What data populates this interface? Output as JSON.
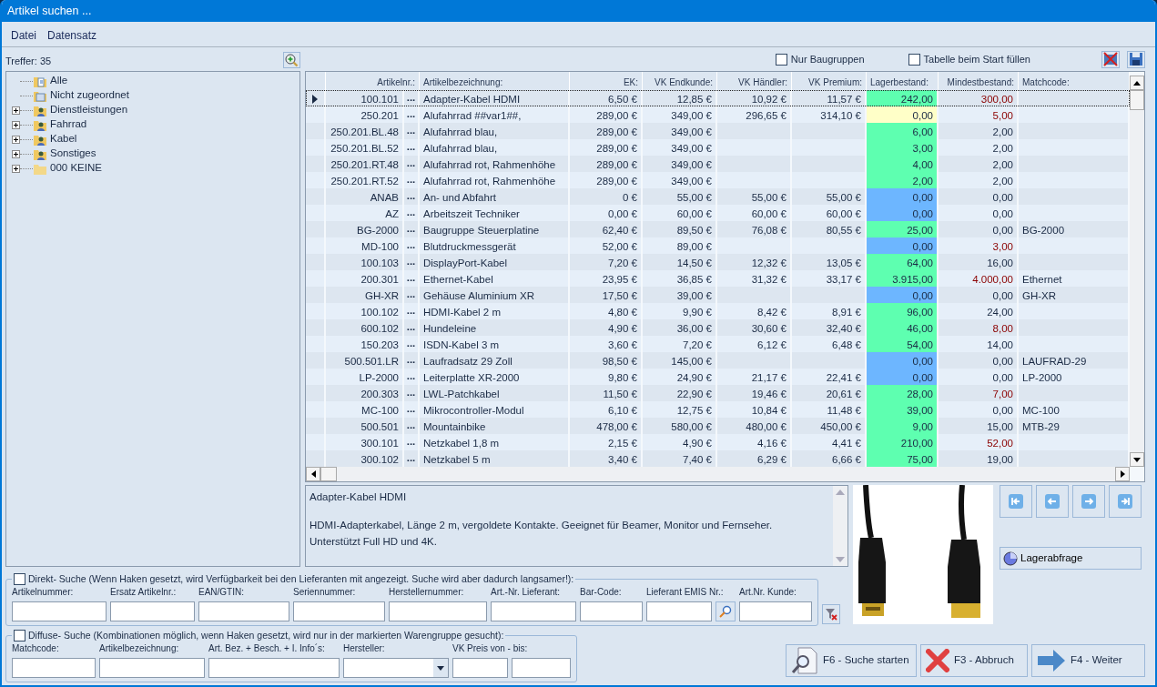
{
  "window": {
    "title": "Artikel suchen ..."
  },
  "menu": [
    "Datei",
    "Datensatz"
  ],
  "hits": "Treffer: 35",
  "tree": [
    {
      "label": "Alle",
      "kind": "all",
      "has_children": false
    },
    {
      "label": "Nicht zugeordnet",
      "kind": "unassigned",
      "has_children": false
    },
    {
      "label": "Dienstleistungen",
      "kind": "group",
      "has_children": true
    },
    {
      "label": "Fahrrad",
      "kind": "group",
      "has_children": true
    },
    {
      "label": "Kabel",
      "kind": "group",
      "has_children": true
    },
    {
      "label": "Sonstiges",
      "kind": "group",
      "has_children": true
    },
    {
      "label": "000 KEINE",
      "kind": "empty",
      "has_children": true
    }
  ],
  "options": [
    {
      "label": "Nur Baugruppen",
      "checked": false
    },
    {
      "label": "Tabelle beim Start füllen",
      "checked": false
    }
  ],
  "table": {
    "columns": [
      "Artikelnr.:",
      "Artikelbezeichnung:",
      "EK:",
      "VK Endkunde:",
      "VK Händler:",
      "VK Premium:",
      "Lagerbestand:",
      "Mindestbestand:",
      "Matchcode:"
    ],
    "rows": [
      {
        "selected": true,
        "artnr": "100.101",
        "more": "...",
        "name": "Adapter-Kabel HDMI",
        "ek": "6,50 €",
        "vk_end": "12,85 €",
        "vk_dealer": "10,92 €",
        "vk_premium": "11,57 €",
        "stock": {
          "value": "242,00",
          "color": "#5effb0"
        },
        "min_stock": {
          "value": "300,00",
          "low": true
        }
      },
      {
        "selected": false,
        "artnr": "250.201",
        "more": "...",
        "name": "Alufahrrad ##var1##,",
        "ek": "289,00 €",
        "vk_end": "349,00 €",
        "vk_dealer": "296,65 €",
        "vk_premium": "314,10 €",
        "stock": {
          "value": "0,00",
          "color": "#ffffc8"
        },
        "min_stock": {
          "value": "5,00",
          "low": true
        }
      },
      {
        "selected": false,
        "artnr": "250.201.BL.48",
        "more": "...",
        "name": "Alufahrrad blau,",
        "ek": "289,00 €",
        "vk_end": "349,00 €",
        "stock": {
          "value": "6,00",
          "color": "#5effb0"
        },
        "min_stock": {
          "value": "2,00",
          "low": false
        }
      },
      {
        "selected": false,
        "artnr": "250.201.BL.52",
        "more": "...",
        "name": "Alufahrrad blau,",
        "ek": "289,00 €",
        "vk_end": "349,00 €",
        "stock": {
          "value": "3,00",
          "color": "#5effb0"
        },
        "min_stock": {
          "value": "2,00",
          "low": false
        }
      },
      {
        "selected": false,
        "artnr": "250.201.RT.48",
        "more": "...",
        "name": "Alufahrrad rot, Rahmenhöhe",
        "ek": "289,00 €",
        "vk_end": "349,00 €",
        "stock": {
          "value": "4,00",
          "color": "#5effb0"
        },
        "min_stock": {
          "value": "2,00",
          "low": false
        }
      },
      {
        "selected": false,
        "artnr": "250.201.RT.52",
        "more": "...",
        "name": "Alufahrrad rot, Rahmenhöhe",
        "ek": "289,00 €",
        "vk_end": "349,00 €",
        "stock": {
          "value": "2,00",
          "color": "#5effb0"
        },
        "min_stock": {
          "value": "2,00",
          "low": false
        }
      },
      {
        "selected": false,
        "artnr": "ANAB",
        "more": "...",
        "name": "An- und Abfahrt",
        "ek": "0 €",
        "vk_end": "55,00 €",
        "vk_dealer": "55,00 €",
        "vk_premium": "55,00 €",
        "stock": {
          "value": "0,00",
          "color": "#6db6ff"
        },
        "min_stock": {
          "value": "0,00",
          "low": false
        }
      },
      {
        "selected": false,
        "artnr": "AZ",
        "more": "...",
        "name": "Arbeitszeit Techniker",
        "ek": "0,00 €",
        "vk_end": "60,00 €",
        "vk_dealer": "60,00 €",
        "vk_premium": "60,00 €",
        "stock": {
          "value": "0,00",
          "color": "#6db6ff"
        },
        "min_stock": {
          "value": "0,00",
          "low": false
        }
      },
      {
        "selected": false,
        "artnr": "BG-2000",
        "more": "...",
        "name": "Baugruppe Steuerplatine",
        "ek": "62,40 €",
        "vk_end": "89,50 €",
        "vk_dealer": "76,08 €",
        "vk_premium": "80,55 €",
        "stock": {
          "value": "25,00",
          "color": "#5effb0"
        },
        "min_stock": {
          "value": "0,00",
          "low": false
        },
        "matchcode": "BG-2000"
      },
      {
        "selected": false,
        "artnr": "MD-100",
        "more": "...",
        "name": "Blutdruckmessgerät",
        "ek": "52,00 €",
        "vk_end": "89,00 €",
        "stock": {
          "value": "0,00",
          "color": "#6db6ff"
        },
        "min_stock": {
          "value": "3,00",
          "low": true
        }
      },
      {
        "selected": false,
        "artnr": "100.103",
        "more": "...",
        "name": "DisplayPort-Kabel",
        "ek": "7,20 €",
        "vk_end": "14,50 €",
        "vk_dealer": "12,32 €",
        "vk_premium": "13,05 €",
        "stock": {
          "value": "64,00",
          "color": "#5effb0"
        },
        "min_stock": {
          "value": "16,00",
          "low": false
        }
      },
      {
        "selected": false,
        "artnr": "200.301",
        "more": "...",
        "name": "Ethernet-Kabel",
        "ek": "23,95 €",
        "vk_end": "36,85 €",
        "vk_dealer": "31,32 €",
        "vk_premium": "33,17 €",
        "stock": {
          "value": "3.915,00",
          "color": "#5effb0"
        },
        "min_stock": {
          "value": "4.000,00",
          "low": true
        },
        "matchcode": "Ethernet"
      },
      {
        "selected": false,
        "artnr": "GH-XR",
        "more": "...",
        "name": "Gehäuse Aluminium XR",
        "ek": "17,50 €",
        "vk_end": "39,00 €",
        "stock": {
          "value": "0,00",
          "color": "#6db6ff"
        },
        "min_stock": {
          "value": "0,00",
          "low": false
        },
        "matchcode": "GH-XR"
      },
      {
        "selected": false,
        "artnr": "100.102",
        "more": "...",
        "name": "HDMI-Kabel 2 m",
        "ek": "4,80 €",
        "vk_end": "9,90 €",
        "vk_dealer": "8,42 €",
        "vk_premium": "8,91 €",
        "stock": {
          "value": "96,00",
          "color": "#5effb0"
        },
        "min_stock": {
          "value": "24,00",
          "low": false
        }
      },
      {
        "selected": false,
        "artnr": "600.102",
        "more": "...",
        "name": "Hundeleine",
        "ek": "4,90 €",
        "vk_end": "36,00 €",
        "vk_dealer": "30,60 €",
        "vk_premium": "32,40 €",
        "stock": {
          "value": "46,00",
          "color": "#5effb0"
        },
        "min_stock": {
          "value": "8,00",
          "low": true
        }
      },
      {
        "selected": false,
        "artnr": "150.203",
        "more": "...",
        "name": "ISDN-Kabel 3 m",
        "ek": "3,60 €",
        "vk_end": "7,20 €",
        "vk_dealer": "6,12 €",
        "vk_premium": "6,48 €",
        "stock": {
          "value": "54,00",
          "color": "#5effb0"
        },
        "min_stock": {
          "value": "14,00",
          "low": false
        }
      },
      {
        "selected": false,
        "artnr": "500.501.LR",
        "more": "...",
        "name": "Laufradsatz 29 Zoll",
        "ek": "98,50 €",
        "vk_end": "145,00 €",
        "stock": {
          "value": "0,00",
          "color": "#6db6ff"
        },
        "min_stock": {
          "value": "0,00",
          "low": false
        },
        "matchcode": "LAUFRAD-29"
      },
      {
        "selected": false,
        "artnr": "LP-2000",
        "more": "...",
        "name": "Leiterplatte XR-2000",
        "ek": "9,80 €",
        "vk_end": "24,90 €",
        "vk_dealer": "21,17 €",
        "vk_premium": "22,41 €",
        "stock": {
          "value": "0,00",
          "color": "#6db6ff"
        },
        "min_stock": {
          "value": "0,00",
          "low": false
        },
        "matchcode": "LP-2000"
      },
      {
        "selected": false,
        "artnr": "200.303",
        "more": "...",
        "name": "LWL-Patchkabel",
        "ek": "11,50 €",
        "vk_end": "22,90 €",
        "vk_dealer": "19,46 €",
        "vk_premium": "20,61 €",
        "stock": {
          "value": "28,00",
          "color": "#5effb0"
        },
        "min_stock": {
          "value": "7,00",
          "low": true
        }
      },
      {
        "selected": false,
        "artnr": "MC-100",
        "more": "...",
        "name": "Mikrocontroller-Modul",
        "ek": "6,10 €",
        "vk_end": "12,75 €",
        "vk_dealer": "10,84 €",
        "vk_premium": "11,48 €",
        "stock": {
          "value": "39,00",
          "color": "#5effb0"
        },
        "min_stock": {
          "value": "0,00",
          "low": false
        },
        "matchcode": "MC-100"
      },
      {
        "selected": false,
        "artnr": "500.501",
        "more": "...",
        "name": "Mountainbike",
        "ek": "478,00 €",
        "vk_end": "580,00 €",
        "vk_dealer": "480,00 €",
        "vk_premium": "450,00 €",
        "stock": {
          "value": "9,00",
          "color": "#5effb0"
        },
        "min_stock": {
          "value": "15,00",
          "low": false
        },
        "matchcode": "MTB-29"
      },
      {
        "selected": false,
        "artnr": "300.101",
        "more": "...",
        "name": "Netzkabel 1,8 m",
        "ek": "2,15 €",
        "vk_end": "4,90 €",
        "vk_dealer": "4,16 €",
        "vk_premium": "4,41 €",
        "stock": {
          "value": "210,00",
          "color": "#5effb0"
        },
        "min_stock": {
          "value": "52,00",
          "low": true
        }
      },
      {
        "selected": false,
        "artnr": "300.102",
        "more": "...",
        "name": "Netzkabel 5 m",
        "ek": "3,40 €",
        "vk_end": "7,40 €",
        "vk_dealer": "6,29 €",
        "vk_premium": "6,66 €",
        "stock": {
          "value": "75,00",
          "color": "#5effb0"
        },
        "min_stock": {
          "value": "19,00",
          "low": false
        }
      }
    ]
  },
  "description": {
    "title": "Adapter-Kabel HDMI",
    "lines": [
      "HDMI-Adapterkabel, Länge 2 m, vergoldete Kontakte. Geeignet für Beamer, Monitor und Fernseher.",
      "Unterstützt Full HD und 4K."
    ]
  },
  "product_image": {
    "kind": "picture"
  },
  "stock_button": "Lagerabfrage",
  "direct_search": {
    "label": "Direkt- Suche (Wenn Haken gesetzt, wird Verfügbarkeit bei den Lieferanten mit angezeigt. Suche wird aber dadurch langsamer!):",
    "checked": false,
    "fields": [
      {
        "label": "Artikelnummer:",
        "kind": "text"
      },
      {
        "label": "Ersatz Artikelnr.:",
        "kind": "text"
      },
      {
        "label": "EAN/GTIN:",
        "kind": "text"
      },
      {
        "label": "Seriennummer:",
        "kind": "text"
      },
      {
        "label": "Herstellernummer:",
        "kind": "text"
      },
      {
        "label": "Art.-Nr. Lieferant:",
        "kind": "text"
      },
      {
        "label": "Bar-Code:",
        "kind": "text"
      },
      {
        "label": "Lieferant EMIS Nr.:",
        "kind": "lookup"
      },
      {
        "label": "Art.Nr. Kunde:",
        "kind": "text"
      }
    ]
  },
  "diffuse_search": {
    "label": "Diffuse- Suche (Kombinationen möglich, wenn Haken gesetzt, wird nur in der markierten Warengruppe gesucht):",
    "checked": false,
    "fields": [
      {
        "label": "Matchcode:",
        "kind": "text"
      },
      {
        "label": "Artikelbezeichnung:",
        "kind": "text"
      },
      {
        "label": "Art. Bez. + Besch. + I. Info´s:",
        "kind": "text"
      },
      {
        "label": "Hersteller:",
        "kind": "select"
      },
      {
        "label": "VK Preis von - bis:",
        "kind": "range"
      }
    ]
  },
  "buttons": [
    {
      "label": "F6 - Suche starten",
      "kind": "search"
    },
    {
      "label": "F3 - Abbruch",
      "kind": "cancel"
    },
    {
      "label": "F4 - Weiter",
      "kind": "next"
    }
  ]
}
